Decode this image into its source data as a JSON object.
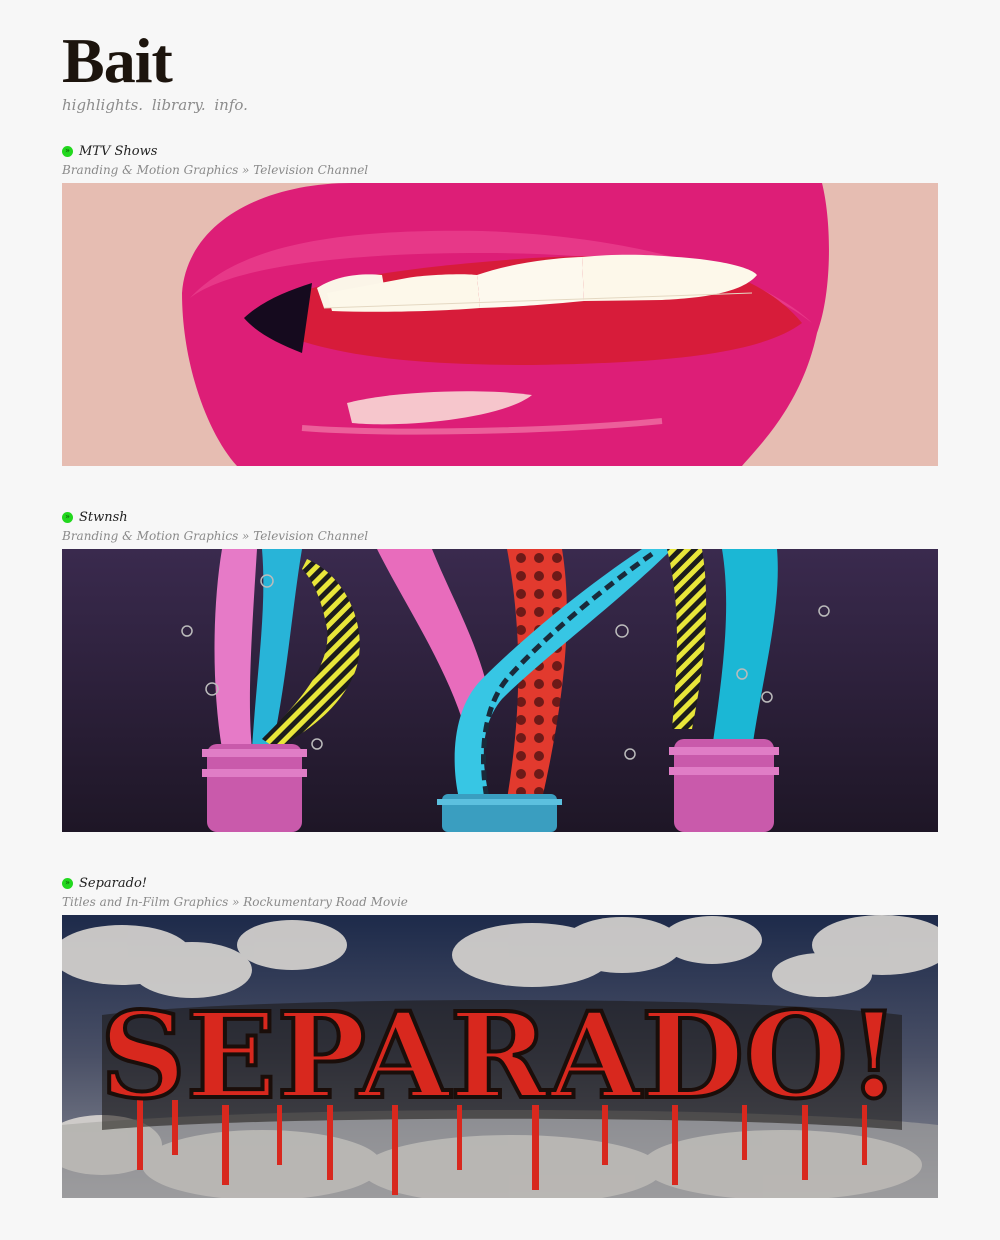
{
  "site": {
    "logo": "Bait",
    "nav": [
      "highlights.",
      "library.",
      "info."
    ]
  },
  "projects": [
    {
      "title": "MTV Shows",
      "subtitle": "Branding & Motion Graphics » Television Channel",
      "image": "pink-lips-illustration"
    },
    {
      "title": "Stwnsh",
      "subtitle": "Branding & Motion Graphics » Television Channel",
      "image": "colorful-tentacles-from-bottles"
    },
    {
      "title": "Separado!",
      "subtitle": "Titles and In-Film Graphics » Rockumentary Road Movie",
      "image": "separado-title-clouds",
      "title_art": "SEPARADO!"
    }
  ],
  "colors": {
    "bullet": "#22d81e",
    "background": "#f7f7f7"
  }
}
